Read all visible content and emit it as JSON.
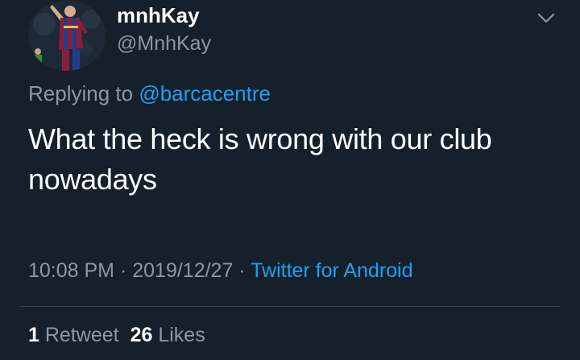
{
  "author": {
    "display_name": "mnhKay",
    "handle": "@MnhKay",
    "avatar_icon": "user-avatar-photo"
  },
  "reply": {
    "prefix": "Replying to",
    "mention": "@barcacentre"
  },
  "tweet": {
    "text": "What the heck is wrong with our club nowadays"
  },
  "meta": {
    "time": "10:08 PM",
    "sep1": " · ",
    "date": "2019/12/27",
    "sep2": " · ",
    "source": "Twitter for Android"
  },
  "stats": {
    "retweets_count": "1",
    "retweets_label": "Retweet",
    "likes_count": "26",
    "likes_label": "Likes"
  },
  "icons": {
    "menu": "chevron-down-icon"
  },
  "colors": {
    "background": "#15202b",
    "primary_text": "#ffffff",
    "secondary_text": "#8899a6",
    "accent": "#1da1f2",
    "divider": "#38444d"
  }
}
